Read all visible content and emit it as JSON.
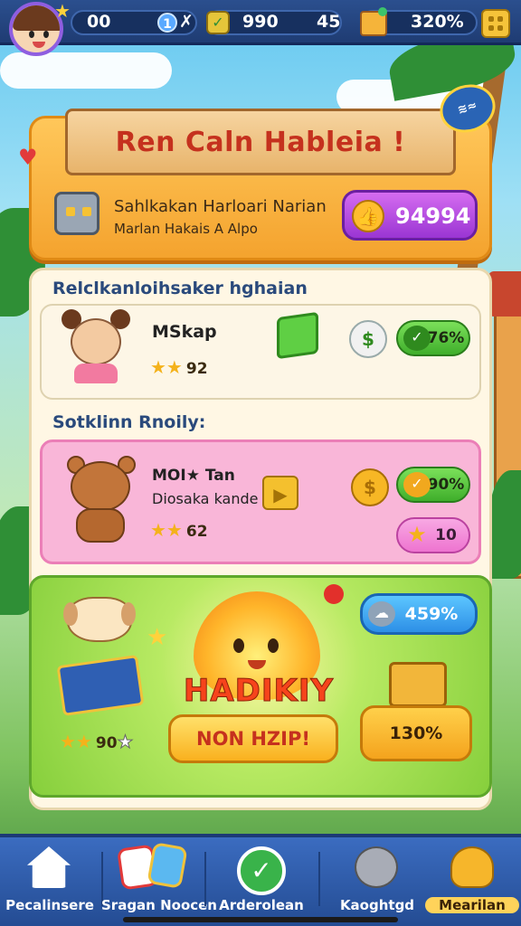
{
  "hud": {
    "lives": "00",
    "level_badge": "1",
    "multiplier_symbol": "✗",
    "gems": "990",
    "energy": "45",
    "chest_pct": "320%"
  },
  "hero": {
    "banner_title": "Ren Caln Hableia !",
    "corner_badge": "≋≈",
    "line1": "Sahlkakan Harloari Narian",
    "line2": "Marlan Hakais A Alpo",
    "buy_value": "94994"
  },
  "section1": {
    "title": "Relclkanloihsaker hghaian",
    "offer": {
      "name": "MSkap",
      "stars": "★★",
      "stars_count": "92",
      "pct": "76%"
    }
  },
  "section2": {
    "title": "Sotklinn Rnoily:",
    "offer": {
      "name": "MOI★ Tan",
      "subtitle": "Diosaka kande",
      "stars": "★★",
      "stars_count": "62",
      "pct": "90%",
      "star_value": "10"
    }
  },
  "reward": {
    "left_stars": "★★",
    "left_value": "90",
    "blue_pill": "459%",
    "big_title": "HADIKIY",
    "claim_label": "NON HZIP!",
    "side_label": "130%"
  },
  "nav": {
    "items": [
      {
        "label": "Pecalinsere"
      },
      {
        "label": "Sragan Noocen"
      },
      {
        "label": "Arderolean"
      },
      {
        "label": "Kaoghtgd"
      },
      {
        "label": "Mearilan"
      }
    ]
  },
  "colors": {
    "accent_orange": "#f4a32e",
    "accent_purple": "#9a35d3",
    "accent_green": "#3fae2b",
    "nav_blue": "#244c93"
  }
}
